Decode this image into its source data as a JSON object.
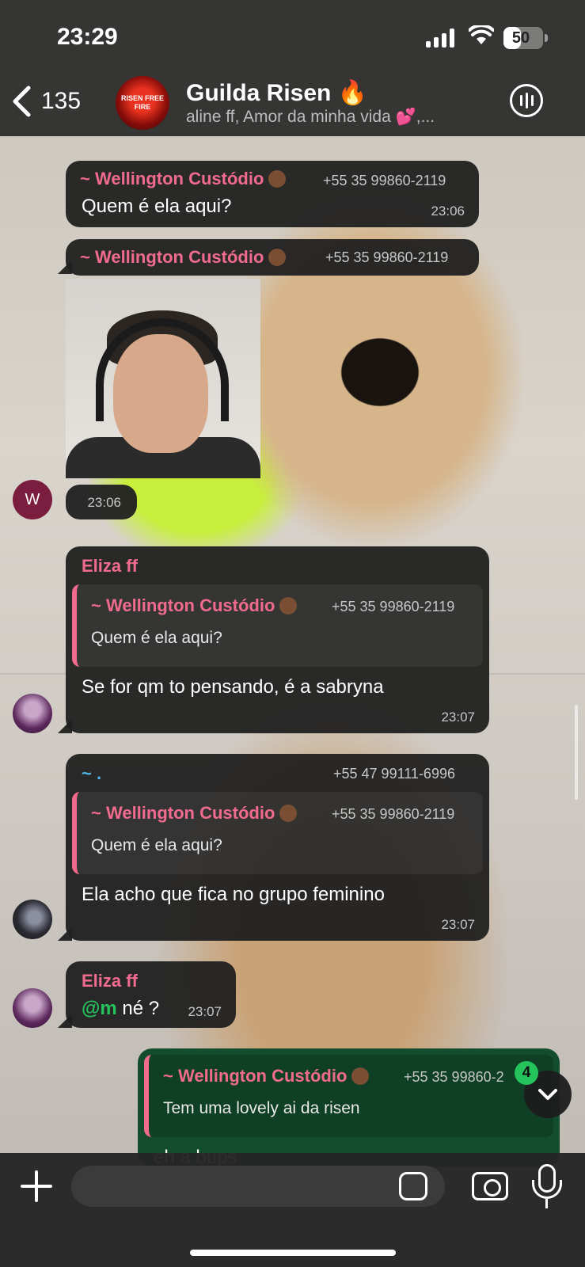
{
  "status_bar": {
    "time": "23:29",
    "battery": "50",
    "battery_level": 0.5
  },
  "header": {
    "back_count": "135",
    "group_avatar_text": "RISEN FREE FIRE",
    "title": "Guilda Risen 🔥",
    "subtitle": "aline ff, Amor da minha vida 💕,..."
  },
  "messages": [
    {
      "sender": "~ Wellington Custódio",
      "phone": "+55 35 99860-2119",
      "text": "Quem é ela aqui?",
      "time": "23:06"
    },
    {
      "sender": "~ Wellington Custódio",
      "phone": "+55 35 99860-2119",
      "time": "23:06",
      "avatar_letter": "W"
    },
    {
      "sender": "Eliza ff",
      "quote_sender": "~ Wellington Custódio",
      "quote_phone": "+55 35 99860-2119",
      "quote_text": "Quem é ela aqui?",
      "text": "Se for qm to pensando, é a sabryna",
      "time": "23:07"
    },
    {
      "sender": "~ .",
      "phone": "+55 47 99111-6996",
      "quote_sender": "~ Wellington Custódio",
      "quote_phone": "+55 35 99860-2119",
      "quote_text": "Quem é ela aqui?",
      "text": "Ela acho que fica no grupo feminino",
      "time": "23:07"
    },
    {
      "sender": "Eliza ff",
      "mention": "@m",
      "text": " né ?",
      "time": "23:07"
    },
    {
      "quote_sender": "~ Wellington Custódio",
      "quote_phone": "+55 35 99860-2",
      "quote_text": "Tem uma lovely ai da risen",
      "text": "eh a bups"
    }
  ],
  "scroll_down": {
    "unread_badge": "4"
  },
  "colors": {
    "sender_pink": "#f16b8e",
    "outgoing_bubble": "#134d2e",
    "badge_green": "#25c35b",
    "mention_green": "#25c35b"
  },
  "icons": [
    "back-chevron-icon",
    "voice-call-icon",
    "plus-icon",
    "sticker-icon",
    "camera-icon",
    "microphone-icon",
    "chevron-down-icon",
    "signal-icon",
    "wifi-icon",
    "battery-icon"
  ]
}
